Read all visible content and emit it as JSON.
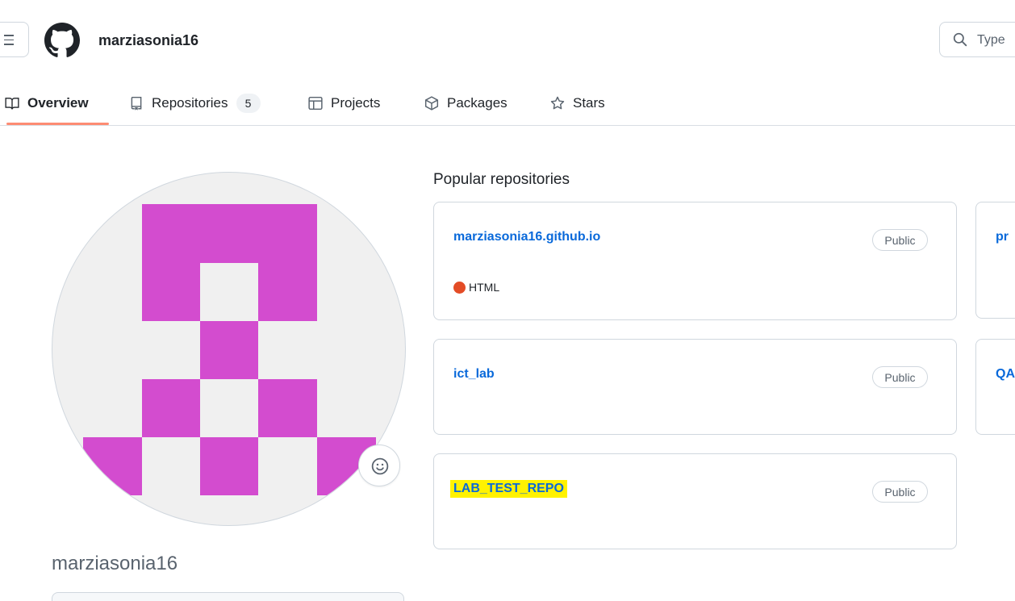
{
  "header": {
    "username": "marziasonia16",
    "search_placeholder": "Type"
  },
  "tabs": [
    {
      "label": "Overview",
      "icon": "book-icon",
      "active": true
    },
    {
      "label": "Repositories",
      "icon": "repo-icon",
      "count": "5"
    },
    {
      "label": "Projects",
      "icon": "table-icon"
    },
    {
      "label": "Packages",
      "icon": "package-icon"
    },
    {
      "label": "Stars",
      "icon": "star-icon"
    }
  ],
  "profile": {
    "username": "marziasonia16",
    "avatar_color": "#d34ccf"
  },
  "popular": {
    "title": "Popular repositories",
    "repos": [
      {
        "name": "marziasonia16.github.io",
        "visibility": "Public",
        "language": "HTML",
        "language_color": "#e34c26"
      },
      {
        "name": "ict_lab",
        "visibility": "Public"
      },
      {
        "name": "LAB_TEST_REPO",
        "visibility": "Public",
        "highlighted": true
      }
    ],
    "partial_repos": [
      {
        "name": "pr"
      },
      {
        "name": "QA"
      }
    ]
  }
}
